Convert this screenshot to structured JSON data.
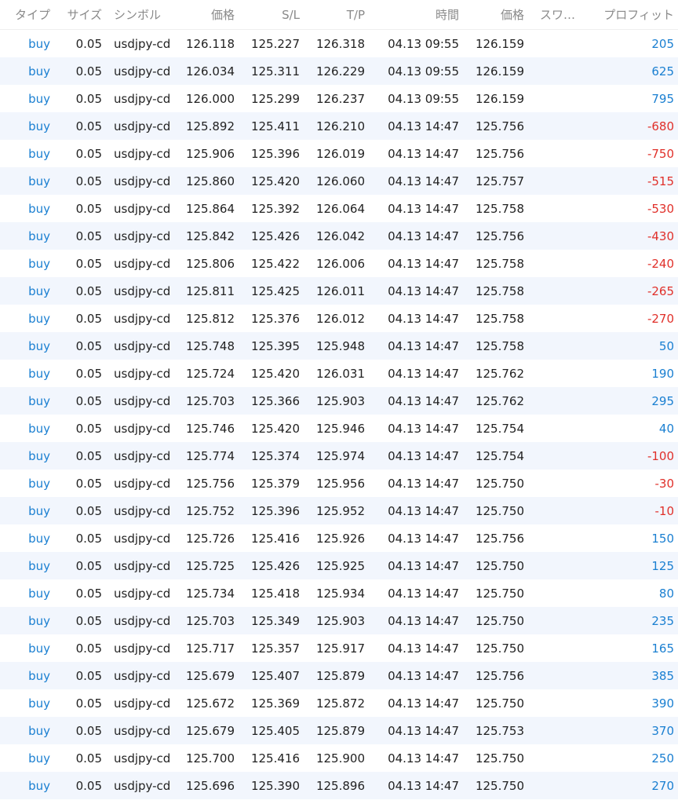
{
  "headers": {
    "type": "タイプ",
    "size": "サイズ",
    "symbol": "シンボル",
    "open_price": "価格",
    "sl": "S/L",
    "tp": "T/P",
    "time": "時間",
    "current_price": "価格",
    "swap": "スワ…",
    "profit": "プロフィット"
  },
  "colors": {
    "buy": "#1a7fd1",
    "profit_positive": "#1a7fd1",
    "profit_negative": "#e0302a",
    "row_alt_background": "#f2f6fd"
  },
  "rows": [
    {
      "type": "buy",
      "size": "0.05",
      "symbol": "usdjpy-cd",
      "open_price": "126.118",
      "sl": "125.227",
      "tp": "126.318",
      "time": "04.13 09:55",
      "current_price": "126.159",
      "swap": "",
      "profit": "205"
    },
    {
      "type": "buy",
      "size": "0.05",
      "symbol": "usdjpy-cd",
      "open_price": "126.034",
      "sl": "125.311",
      "tp": "126.229",
      "time": "04.13 09:55",
      "current_price": "126.159",
      "swap": "",
      "profit": "625"
    },
    {
      "type": "buy",
      "size": "0.05",
      "symbol": "usdjpy-cd",
      "open_price": "126.000",
      "sl": "125.299",
      "tp": "126.237",
      "time": "04.13 09:55",
      "current_price": "126.159",
      "swap": "",
      "profit": "795"
    },
    {
      "type": "buy",
      "size": "0.05",
      "symbol": "usdjpy-cd",
      "open_price": "125.892",
      "sl": "125.411",
      "tp": "126.210",
      "time": "04.13 14:47",
      "current_price": "125.756",
      "swap": "",
      "profit": "-680"
    },
    {
      "type": "buy",
      "size": "0.05",
      "symbol": "usdjpy-cd",
      "open_price": "125.906",
      "sl": "125.396",
      "tp": "126.019",
      "time": "04.13 14:47",
      "current_price": "125.756",
      "swap": "",
      "profit": "-750"
    },
    {
      "type": "buy",
      "size": "0.05",
      "symbol": "usdjpy-cd",
      "open_price": "125.860",
      "sl": "125.420",
      "tp": "126.060",
      "time": "04.13 14:47",
      "current_price": "125.757",
      "swap": "",
      "profit": "-515"
    },
    {
      "type": "buy",
      "size": "0.05",
      "symbol": "usdjpy-cd",
      "open_price": "125.864",
      "sl": "125.392",
      "tp": "126.064",
      "time": "04.13 14:47",
      "current_price": "125.758",
      "swap": "",
      "profit": "-530"
    },
    {
      "type": "buy",
      "size": "0.05",
      "symbol": "usdjpy-cd",
      "open_price": "125.842",
      "sl": "125.426",
      "tp": "126.042",
      "time": "04.13 14:47",
      "current_price": "125.756",
      "swap": "",
      "profit": "-430"
    },
    {
      "type": "buy",
      "size": "0.05",
      "symbol": "usdjpy-cd",
      "open_price": "125.806",
      "sl": "125.422",
      "tp": "126.006",
      "time": "04.13 14:47",
      "current_price": "125.758",
      "swap": "",
      "profit": "-240"
    },
    {
      "type": "buy",
      "size": "0.05",
      "symbol": "usdjpy-cd",
      "open_price": "125.811",
      "sl": "125.425",
      "tp": "126.011",
      "time": "04.13 14:47",
      "current_price": "125.758",
      "swap": "",
      "profit": "-265"
    },
    {
      "type": "buy",
      "size": "0.05",
      "symbol": "usdjpy-cd",
      "open_price": "125.812",
      "sl": "125.376",
      "tp": "126.012",
      "time": "04.13 14:47",
      "current_price": "125.758",
      "swap": "",
      "profit": "-270"
    },
    {
      "type": "buy",
      "size": "0.05",
      "symbol": "usdjpy-cd",
      "open_price": "125.748",
      "sl": "125.395",
      "tp": "125.948",
      "time": "04.13 14:47",
      "current_price": "125.758",
      "swap": "",
      "profit": "50"
    },
    {
      "type": "buy",
      "size": "0.05",
      "symbol": "usdjpy-cd",
      "open_price": "125.724",
      "sl": "125.420",
      "tp": "126.031",
      "time": "04.13 14:47",
      "current_price": "125.762",
      "swap": "",
      "profit": "190"
    },
    {
      "type": "buy",
      "size": "0.05",
      "symbol": "usdjpy-cd",
      "open_price": "125.703",
      "sl": "125.366",
      "tp": "125.903",
      "time": "04.13 14:47",
      "current_price": "125.762",
      "swap": "",
      "profit": "295"
    },
    {
      "type": "buy",
      "size": "0.05",
      "symbol": "usdjpy-cd",
      "open_price": "125.746",
      "sl": "125.420",
      "tp": "125.946",
      "time": "04.13 14:47",
      "current_price": "125.754",
      "swap": "",
      "profit": "40"
    },
    {
      "type": "buy",
      "size": "0.05",
      "symbol": "usdjpy-cd",
      "open_price": "125.774",
      "sl": "125.374",
      "tp": "125.974",
      "time": "04.13 14:47",
      "current_price": "125.754",
      "swap": "",
      "profit": "-100"
    },
    {
      "type": "buy",
      "size": "0.05",
      "symbol": "usdjpy-cd",
      "open_price": "125.756",
      "sl": "125.379",
      "tp": "125.956",
      "time": "04.13 14:47",
      "current_price": "125.750",
      "swap": "",
      "profit": "-30"
    },
    {
      "type": "buy",
      "size": "0.05",
      "symbol": "usdjpy-cd",
      "open_price": "125.752",
      "sl": "125.396",
      "tp": "125.952",
      "time": "04.13 14:47",
      "current_price": "125.750",
      "swap": "",
      "profit": "-10"
    },
    {
      "type": "buy",
      "size": "0.05",
      "symbol": "usdjpy-cd",
      "open_price": "125.726",
      "sl": "125.416",
      "tp": "125.926",
      "time": "04.13 14:47",
      "current_price": "125.756",
      "swap": "",
      "profit": "150"
    },
    {
      "type": "buy",
      "size": "0.05",
      "symbol": "usdjpy-cd",
      "open_price": "125.725",
      "sl": "125.426",
      "tp": "125.925",
      "time": "04.13 14:47",
      "current_price": "125.750",
      "swap": "",
      "profit": "125"
    },
    {
      "type": "buy",
      "size": "0.05",
      "symbol": "usdjpy-cd",
      "open_price": "125.734",
      "sl": "125.418",
      "tp": "125.934",
      "time": "04.13 14:47",
      "current_price": "125.750",
      "swap": "",
      "profit": "80"
    },
    {
      "type": "buy",
      "size": "0.05",
      "symbol": "usdjpy-cd",
      "open_price": "125.703",
      "sl": "125.349",
      "tp": "125.903",
      "time": "04.13 14:47",
      "current_price": "125.750",
      "swap": "",
      "profit": "235"
    },
    {
      "type": "buy",
      "size": "0.05",
      "symbol": "usdjpy-cd",
      "open_price": "125.717",
      "sl": "125.357",
      "tp": "125.917",
      "time": "04.13 14:47",
      "current_price": "125.750",
      "swap": "",
      "profit": "165"
    },
    {
      "type": "buy",
      "size": "0.05",
      "symbol": "usdjpy-cd",
      "open_price": "125.679",
      "sl": "125.407",
      "tp": "125.879",
      "time": "04.13 14:47",
      "current_price": "125.756",
      "swap": "",
      "profit": "385"
    },
    {
      "type": "buy",
      "size": "0.05",
      "symbol": "usdjpy-cd",
      "open_price": "125.672",
      "sl": "125.369",
      "tp": "125.872",
      "time": "04.13 14:47",
      "current_price": "125.750",
      "swap": "",
      "profit": "390"
    },
    {
      "type": "buy",
      "size": "0.05",
      "symbol": "usdjpy-cd",
      "open_price": "125.679",
      "sl": "125.405",
      "tp": "125.879",
      "time": "04.13 14:47",
      "current_price": "125.753",
      "swap": "",
      "profit": "370"
    },
    {
      "type": "buy",
      "size": "0.05",
      "symbol": "usdjpy-cd",
      "open_price": "125.700",
      "sl": "125.416",
      "tp": "125.900",
      "time": "04.13 14:47",
      "current_price": "125.750",
      "swap": "",
      "profit": "250"
    },
    {
      "type": "buy",
      "size": "0.05",
      "symbol": "usdjpy-cd",
      "open_price": "125.696",
      "sl": "125.390",
      "tp": "125.896",
      "time": "04.13 14:47",
      "current_price": "125.750",
      "swap": "",
      "profit": "270"
    }
  ]
}
